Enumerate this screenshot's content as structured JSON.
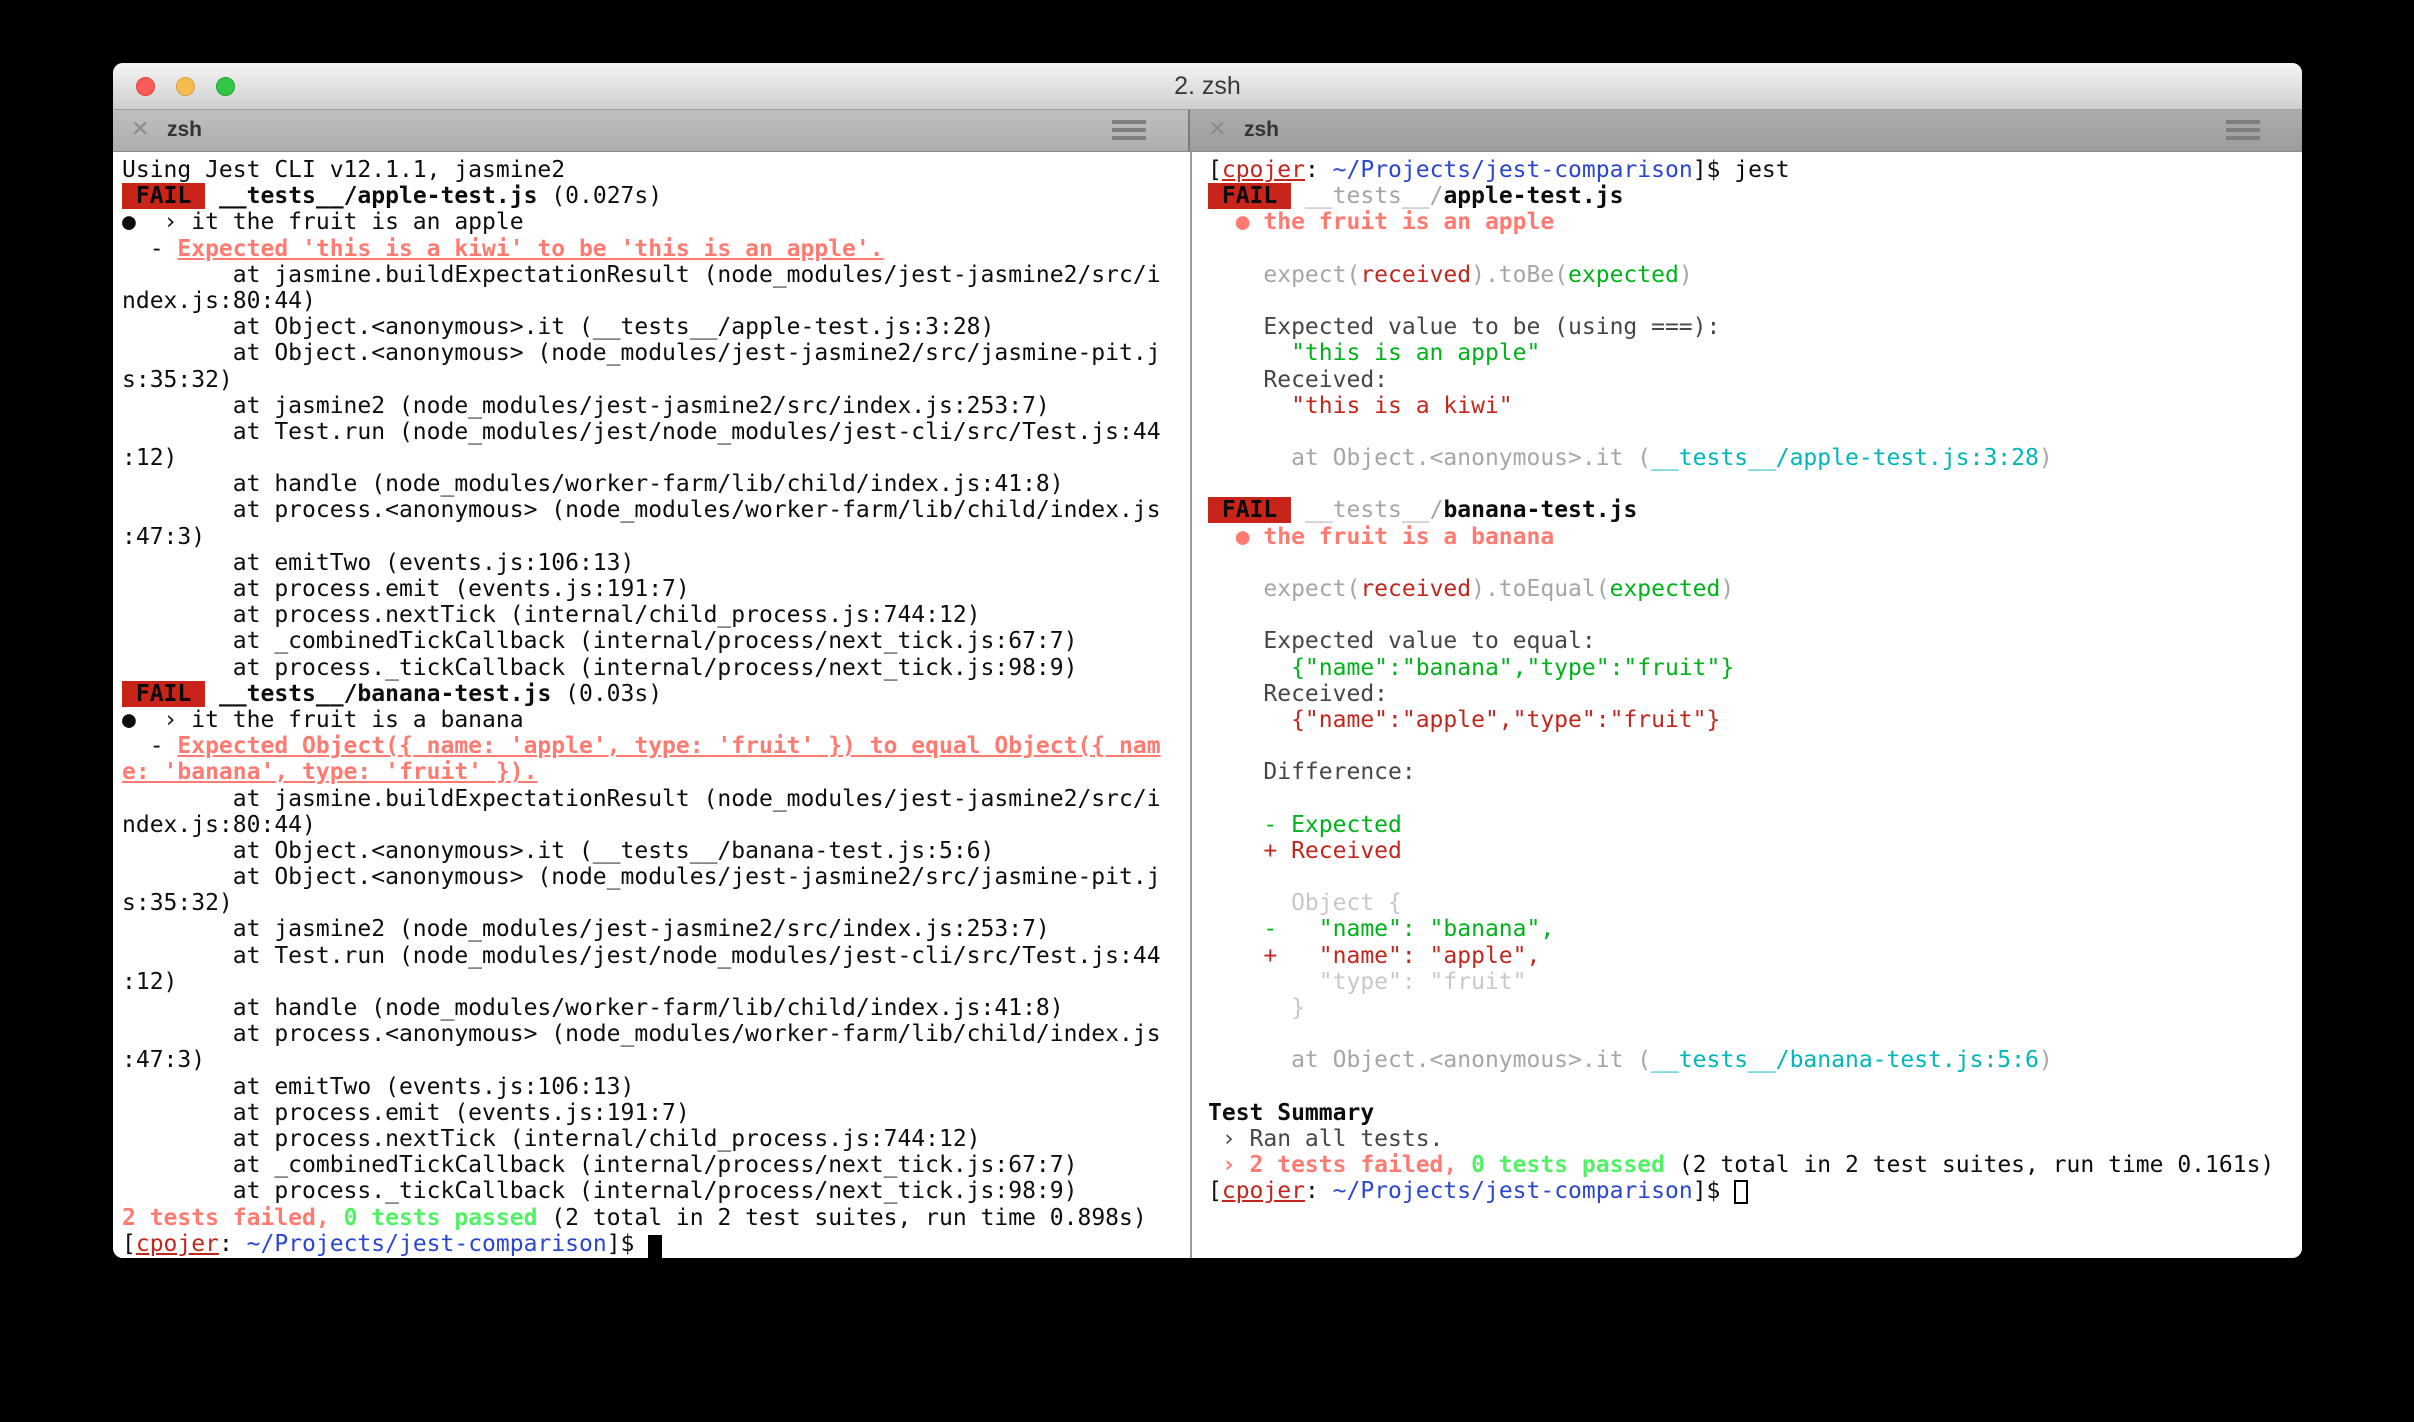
{
  "window": {
    "title": "2. zsh"
  },
  "chrome": {
    "close_icon": "✕"
  },
  "colors": {
    "trafficRed": "#fc5b57",
    "trafficYellow": "#f5bd4f",
    "trafficGreen": "#33c748",
    "titleText": "#3a3a3a",
    "failBadgeBg": "#c9241a",
    "failBadgeText": "#0a0a0a",
    "defaultText": "#0d0d0d",
    "softText": "#464646",
    "red": "#c3261d",
    "green": "#00b21a",
    "salmon": "#ff7b72",
    "brightGreen": "#53f266",
    "gray": "#a6a6a6",
    "lightGray": "#c8c8c8",
    "cyan": "#00b6b8",
    "blue": "#2b46cf"
  },
  "left_pane": {
    "tab_label": "zsh",
    "lines": [
      [
        {
          "c": "def",
          "t": "Using Jest CLI v12.1.1, jasmine2"
        }
      ],
      [
        {
          "c": "badge",
          "t": " FAIL "
        },
        {
          "c": "def",
          "t": " "
        },
        {
          "c": "def b",
          "t": "__tests__/apple-test.js"
        },
        {
          "c": "def",
          "t": " (0.027s)"
        }
      ],
      [
        {
          "c": "def",
          "t": "●  › it the fruit is an apple"
        }
      ],
      [
        {
          "c": "def",
          "t": "  - "
        },
        {
          "c": "sal b u",
          "t": "Expected 'this is a kiwi' to be 'this is an apple'."
        }
      ],
      [
        {
          "c": "def",
          "t": "        at jasmine.buildExpectationResult (node_modules/jest-jasmine2/src/i"
        }
      ],
      [
        {
          "c": "def",
          "t": "ndex.js:80:44)"
        }
      ],
      [
        {
          "c": "def",
          "t": "        at Object.<anonymous>.it (__tests__/apple-test.js:3:28)"
        }
      ],
      [
        {
          "c": "def",
          "t": "        at Object.<anonymous> (node_modules/jest-jasmine2/src/jasmine-pit.j"
        }
      ],
      [
        {
          "c": "def",
          "t": "s:35:32)"
        }
      ],
      [
        {
          "c": "def",
          "t": "        at jasmine2 (node_modules/jest-jasmine2/src/index.js:253:7)"
        }
      ],
      [
        {
          "c": "def",
          "t": "        at Test.run (node_modules/jest/node_modules/jest-cli/src/Test.js:44"
        }
      ],
      [
        {
          "c": "def",
          "t": ":12)"
        }
      ],
      [
        {
          "c": "def",
          "t": "        at handle (node_modules/worker-farm/lib/child/index.js:41:8)"
        }
      ],
      [
        {
          "c": "def",
          "t": "        at process.<anonymous> (node_modules/worker-farm/lib/child/index.js"
        }
      ],
      [
        {
          "c": "def",
          "t": ":47:3)"
        }
      ],
      [
        {
          "c": "def",
          "t": "        at emitTwo (events.js:106:13)"
        }
      ],
      [
        {
          "c": "def",
          "t": "        at process.emit (events.js:191:7)"
        }
      ],
      [
        {
          "c": "def",
          "t": "        at process.nextTick (internal/child_process.js:744:12)"
        }
      ],
      [
        {
          "c": "def",
          "t": "        at _combinedTickCallback (internal/process/next_tick.js:67:7)"
        }
      ],
      [
        {
          "c": "def",
          "t": "        at process._tickCallback (internal/process/next_tick.js:98:9)"
        }
      ],
      [
        {
          "c": "badge",
          "t": " FAIL "
        },
        {
          "c": "def",
          "t": " "
        },
        {
          "c": "def b",
          "t": "__tests__/banana-test.js"
        },
        {
          "c": "def",
          "t": " (0.03s)"
        }
      ],
      [
        {
          "c": "def",
          "t": "●  › it the fruit is a banana"
        }
      ],
      [
        {
          "c": "def",
          "t": "  - "
        },
        {
          "c": "sal b u",
          "t": "Expected Object({ name: 'apple', type: 'fruit' }) to equal Object({ nam"
        }
      ],
      [
        {
          "c": "sal b u",
          "t": "e: 'banana', type: 'fruit' })."
        }
      ],
      [
        {
          "c": "def",
          "t": "        at jasmine.buildExpectationResult (node_modules/jest-jasmine2/src/i"
        }
      ],
      [
        {
          "c": "def",
          "t": "ndex.js:80:44)"
        }
      ],
      [
        {
          "c": "def",
          "t": "        at Object.<anonymous>.it (__tests__/banana-test.js:5:6)"
        }
      ],
      [
        {
          "c": "def",
          "t": "        at Object.<anonymous> (node_modules/jest-jasmine2/src/jasmine-pit.j"
        }
      ],
      [
        {
          "c": "def",
          "t": "s:35:32)"
        }
      ],
      [
        {
          "c": "def",
          "t": "        at jasmine2 (node_modules/jest-jasmine2/src/index.js:253:7)"
        }
      ],
      [
        {
          "c": "def",
          "t": "        at Test.run (node_modules/jest/node_modules/jest-cli/src/Test.js:44"
        }
      ],
      [
        {
          "c": "def",
          "t": ":12)"
        }
      ],
      [
        {
          "c": "def",
          "t": "        at handle (node_modules/worker-farm/lib/child/index.js:41:8)"
        }
      ],
      [
        {
          "c": "def",
          "t": "        at process.<anonymous> (node_modules/worker-farm/lib/child/index.js"
        }
      ],
      [
        {
          "c": "def",
          "t": ":47:3)"
        }
      ],
      [
        {
          "c": "def",
          "t": "        at emitTwo (events.js:106:13)"
        }
      ],
      [
        {
          "c": "def",
          "t": "        at process.emit (events.js:191:7)"
        }
      ],
      [
        {
          "c": "def",
          "t": "        at process.nextTick (internal/child_process.js:744:12)"
        }
      ],
      [
        {
          "c": "def",
          "t": "        at _combinedTickCallback (internal/process/next_tick.js:67:7)"
        }
      ],
      [
        {
          "c": "def",
          "t": "        at process._tickCallback (internal/process/next_tick.js:98:9)"
        }
      ],
      [
        {
          "c": "sal b",
          "t": "2 tests failed,"
        },
        {
          "c": "def",
          "t": " "
        },
        {
          "c": "bgr b",
          "t": "0 tests passed"
        },
        {
          "c": "def",
          "t": " (2 total in 2 test suites, run time 0.898s)"
        }
      ],
      [
        {
          "c": "def",
          "t": "["
        },
        {
          "c": "red u",
          "t": "cpojer"
        },
        {
          "c": "def",
          "t": ": "
        },
        {
          "c": "blu",
          "t": "~/Projects/jest-comparison"
        },
        {
          "c": "def",
          "t": "]$ "
        },
        {
          "c": "cur",
          "t": " "
        }
      ]
    ]
  },
  "right_pane": {
    "tab_label": "zsh",
    "lines": [
      [
        {
          "c": "def",
          "t": "["
        },
        {
          "c": "red u",
          "t": "cpojer"
        },
        {
          "c": "def",
          "t": ": "
        },
        {
          "c": "blu",
          "t": "~/Projects/jest-comparison"
        },
        {
          "c": "def",
          "t": "]$ jest"
        }
      ],
      [
        {
          "c": "badge",
          "t": " FAIL "
        },
        {
          "c": "def",
          "t": " "
        },
        {
          "c": "gry",
          "t": "__tests__/"
        },
        {
          "c": "def b",
          "t": "apple-test.js"
        }
      ],
      [
        {
          "c": "sal b",
          "t": "  ● the fruit is an apple"
        }
      ],
      [],
      [
        {
          "c": "gry",
          "t": "    expect("
        },
        {
          "c": "red",
          "t": "received"
        },
        {
          "c": "gry",
          "t": ").toBe("
        },
        {
          "c": "grn",
          "t": "expected"
        },
        {
          "c": "gry",
          "t": ")"
        }
      ],
      [],
      [
        {
          "c": "soft",
          "t": "    Expected value to be (using ===):"
        }
      ],
      [
        {
          "c": "grn",
          "t": "      \"this is an apple\""
        }
      ],
      [
        {
          "c": "soft",
          "t": "    Received:"
        }
      ],
      [
        {
          "c": "red",
          "t": "      \"this is a kiwi\""
        }
      ],
      [],
      [
        {
          "c": "gry",
          "t": "      at Object.<anonymous>.it ("
        },
        {
          "c": "cyn",
          "t": "__tests__/apple-test.js:3:28"
        },
        {
          "c": "gry",
          "t": ")"
        }
      ],
      [],
      [
        {
          "c": "badge",
          "t": " FAIL "
        },
        {
          "c": "def",
          "t": " "
        },
        {
          "c": "gry",
          "t": "__tests__/"
        },
        {
          "c": "def b",
          "t": "banana-test.js"
        }
      ],
      [
        {
          "c": "sal b",
          "t": "  ● the fruit is a banana"
        }
      ],
      [],
      [
        {
          "c": "gry",
          "t": "    expect("
        },
        {
          "c": "red",
          "t": "received"
        },
        {
          "c": "gry",
          "t": ").toEqual("
        },
        {
          "c": "grn",
          "t": "expected"
        },
        {
          "c": "gry",
          "t": ")"
        }
      ],
      [],
      [
        {
          "c": "soft",
          "t": "    Expected value to equal:"
        }
      ],
      [
        {
          "c": "grn",
          "t": "      {\"name\":\"banana\",\"type\":\"fruit\"}"
        }
      ],
      [
        {
          "c": "soft",
          "t": "    Received:"
        }
      ],
      [
        {
          "c": "red",
          "t": "      {\"name\":\"apple\",\"type\":\"fruit\"}"
        }
      ],
      [],
      [
        {
          "c": "soft",
          "t": "    Difference:"
        }
      ],
      [],
      [
        {
          "c": "grn",
          "t": "    - Expected"
        }
      ],
      [
        {
          "c": "red",
          "t": "    + Received"
        }
      ],
      [],
      [
        {
          "c": "lgy",
          "t": "      Object {"
        }
      ],
      [
        {
          "c": "grn",
          "t": "    -   \"name\": \"banana\","
        }
      ],
      [
        {
          "c": "red",
          "t": "    +   \"name\": \"apple\","
        }
      ],
      [
        {
          "c": "lgy",
          "t": "        \"type\": \"fruit\""
        }
      ],
      [
        {
          "c": "lgy",
          "t": "      }"
        }
      ],
      [],
      [
        {
          "c": "gry",
          "t": "      at Object.<anonymous>.it ("
        },
        {
          "c": "cyn",
          "t": "__tests__/banana-test.js:5:6"
        },
        {
          "c": "gry",
          "t": ")"
        }
      ],
      [],
      [
        {
          "c": "def b",
          "t": "Test Summary"
        }
      ],
      [
        {
          "c": "soft",
          "t": " › Ran all tests."
        }
      ],
      [
        {
          "c": "sal b",
          "t": " › 2 tests failed,"
        },
        {
          "c": "def",
          "t": " "
        },
        {
          "c": "bgr b",
          "t": "0 tests passed"
        },
        {
          "c": "def",
          "t": " (2 total in 2 test suites, run time 0.161s)"
        }
      ],
      [
        {
          "c": "def",
          "t": "["
        },
        {
          "c": "red u",
          "t": "cpojer"
        },
        {
          "c": "def",
          "t": ": "
        },
        {
          "c": "blu",
          "t": "~/Projects/jest-comparison"
        },
        {
          "c": "def",
          "t": "]$ "
        },
        {
          "c": "curh",
          "t": " "
        }
      ]
    ]
  }
}
